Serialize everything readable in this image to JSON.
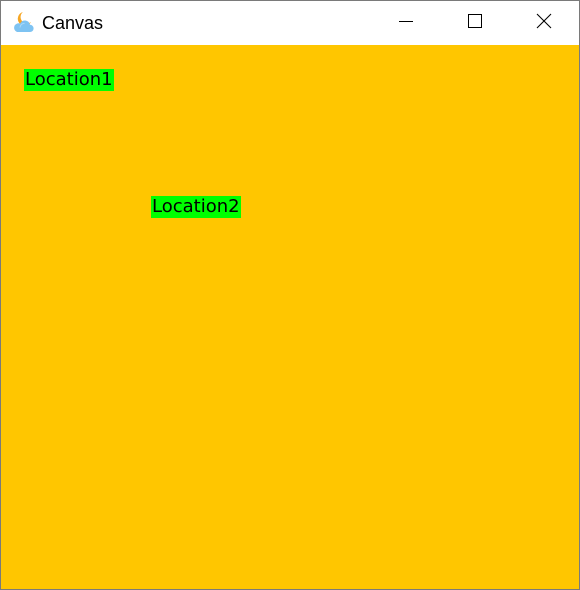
{
  "window": {
    "title": "Canvas",
    "icon": "weather-moon-cloud-icon"
  },
  "titlebar_buttons": {
    "minimize": "minimize-icon",
    "maximize": "maximize-icon",
    "close": "close-icon"
  },
  "canvas": {
    "background_color": "#FFC600",
    "labels": [
      {
        "text": "Location1",
        "background_color": "#00FF00"
      },
      {
        "text": "Location2",
        "background_color": "#00FF00"
      }
    ]
  }
}
